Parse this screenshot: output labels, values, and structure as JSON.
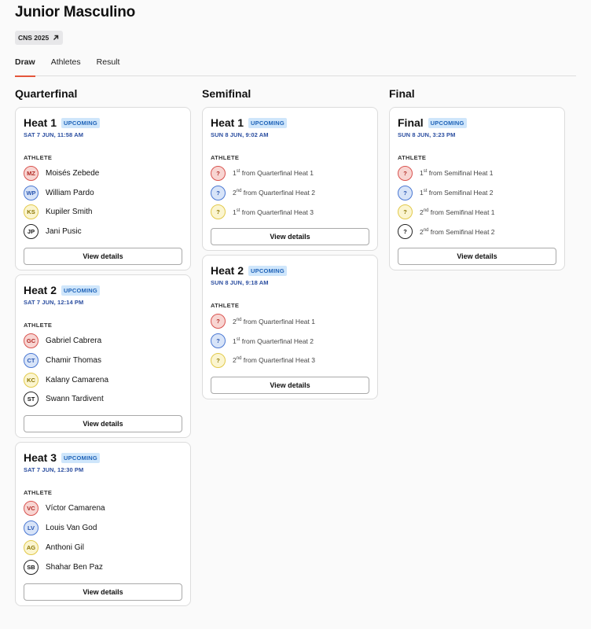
{
  "page": {
    "title": "Junior Masculino",
    "badge": "CNS 2025"
  },
  "tabs": [
    {
      "label": "Draw",
      "active": true
    },
    {
      "label": "Athletes",
      "active": false
    },
    {
      "label": "Result",
      "active": false
    }
  ],
  "colors": {
    "accent": "#e4553b",
    "status_bg": "#cfe6fb",
    "status_text": "#1f63b8",
    "time_text": "#2b4ea0"
  },
  "rounds": [
    {
      "title": "Quarterfinal",
      "heats": [
        {
          "name": "Heat 1",
          "status": "UPCOMING",
          "time": "SAT 7 JUN, 11:58 AM",
          "athlete_header": "ATHLETE",
          "button": "View details",
          "athletes": [
            {
              "initials": "MZ",
              "name": "Moisés Zebede",
              "color": "red"
            },
            {
              "initials": "WP",
              "name": "William Pardo",
              "color": "blue"
            },
            {
              "initials": "KS",
              "name": "Kupiler Smith",
              "color": "yellow"
            },
            {
              "initials": "JP",
              "name": "Jani Pusic",
              "color": "white"
            }
          ]
        },
        {
          "name": "Heat 2",
          "status": "UPCOMING",
          "time": "SAT 7 JUN, 12:14 PM",
          "athlete_header": "ATHLETE",
          "button": "View details",
          "athletes": [
            {
              "initials": "GC",
              "name": "Gabriel Cabrera",
              "color": "red"
            },
            {
              "initials": "CT",
              "name": "Chamir Thomas",
              "color": "blue"
            },
            {
              "initials": "KC",
              "name": "Kalany Camarena",
              "color": "yellow"
            },
            {
              "initials": "ST",
              "name": "Swann Tardivent",
              "color": "white"
            }
          ]
        },
        {
          "name": "Heat 3",
          "status": "UPCOMING",
          "time": "SAT 7 JUN, 12:30 PM",
          "athlete_header": "ATHLETE",
          "button": "View details",
          "athletes": [
            {
              "initials": "VC",
              "name": "Víctor Camarena",
              "color": "red"
            },
            {
              "initials": "LV",
              "name": "Louis Van God",
              "color": "blue"
            },
            {
              "initials": "AG",
              "name": "Anthoni Gil",
              "color": "yellow"
            },
            {
              "initials": "SB",
              "name": "Shahar Ben Paz",
              "color": "white"
            }
          ]
        }
      ]
    },
    {
      "title": "Semifinal",
      "heats": [
        {
          "name": "Heat 1",
          "status": "UPCOMING",
          "time": "SUN 8 JUN, 9:02 AM",
          "athlete_header": "ATHLETE",
          "button": "View details",
          "athletes": [
            {
              "initials": "?",
              "rank": "1",
              "suffix": "st",
              "from": "from Quarterfinal Heat 1",
              "color": "red"
            },
            {
              "initials": "?",
              "rank": "2",
              "suffix": "nd",
              "from": "from Quarterfinal Heat 2",
              "color": "blue"
            },
            {
              "initials": "?",
              "rank": "1",
              "suffix": "st",
              "from": "from Quarterfinal Heat 3",
              "color": "yellow"
            }
          ]
        },
        {
          "name": "Heat 2",
          "status": "UPCOMING",
          "time": "SUN 8 JUN, 9:18 AM",
          "athlete_header": "ATHLETE",
          "button": "View details",
          "athletes": [
            {
              "initials": "?",
              "rank": "2",
              "suffix": "nd",
              "from": "from Quarterfinal Heat 1",
              "color": "red"
            },
            {
              "initials": "?",
              "rank": "1",
              "suffix": "st",
              "from": "from Quarterfinal Heat 2",
              "color": "blue"
            },
            {
              "initials": "?",
              "rank": "2",
              "suffix": "nd",
              "from": "from Quarterfinal Heat 3",
              "color": "yellow"
            }
          ]
        }
      ]
    },
    {
      "title": "Final",
      "heats": [
        {
          "name": "Final",
          "status": "UPCOMING",
          "time": "SUN 8 JUN, 3:23 PM",
          "athlete_header": "ATHLETE",
          "button": "View details",
          "athletes": [
            {
              "initials": "?",
              "rank": "1",
              "suffix": "st",
              "from": "from Semifinal Heat 1",
              "color": "red"
            },
            {
              "initials": "?",
              "rank": "1",
              "suffix": "st",
              "from": "from Semifinal Heat 2",
              "color": "blue"
            },
            {
              "initials": "?",
              "rank": "2",
              "suffix": "nd",
              "from": "from Semifinal Heat 1",
              "color": "yellow"
            },
            {
              "initials": "?",
              "rank": "2",
              "suffix": "nd",
              "from": "from Semifinal Heat 2",
              "color": "white"
            }
          ]
        }
      ]
    }
  ]
}
